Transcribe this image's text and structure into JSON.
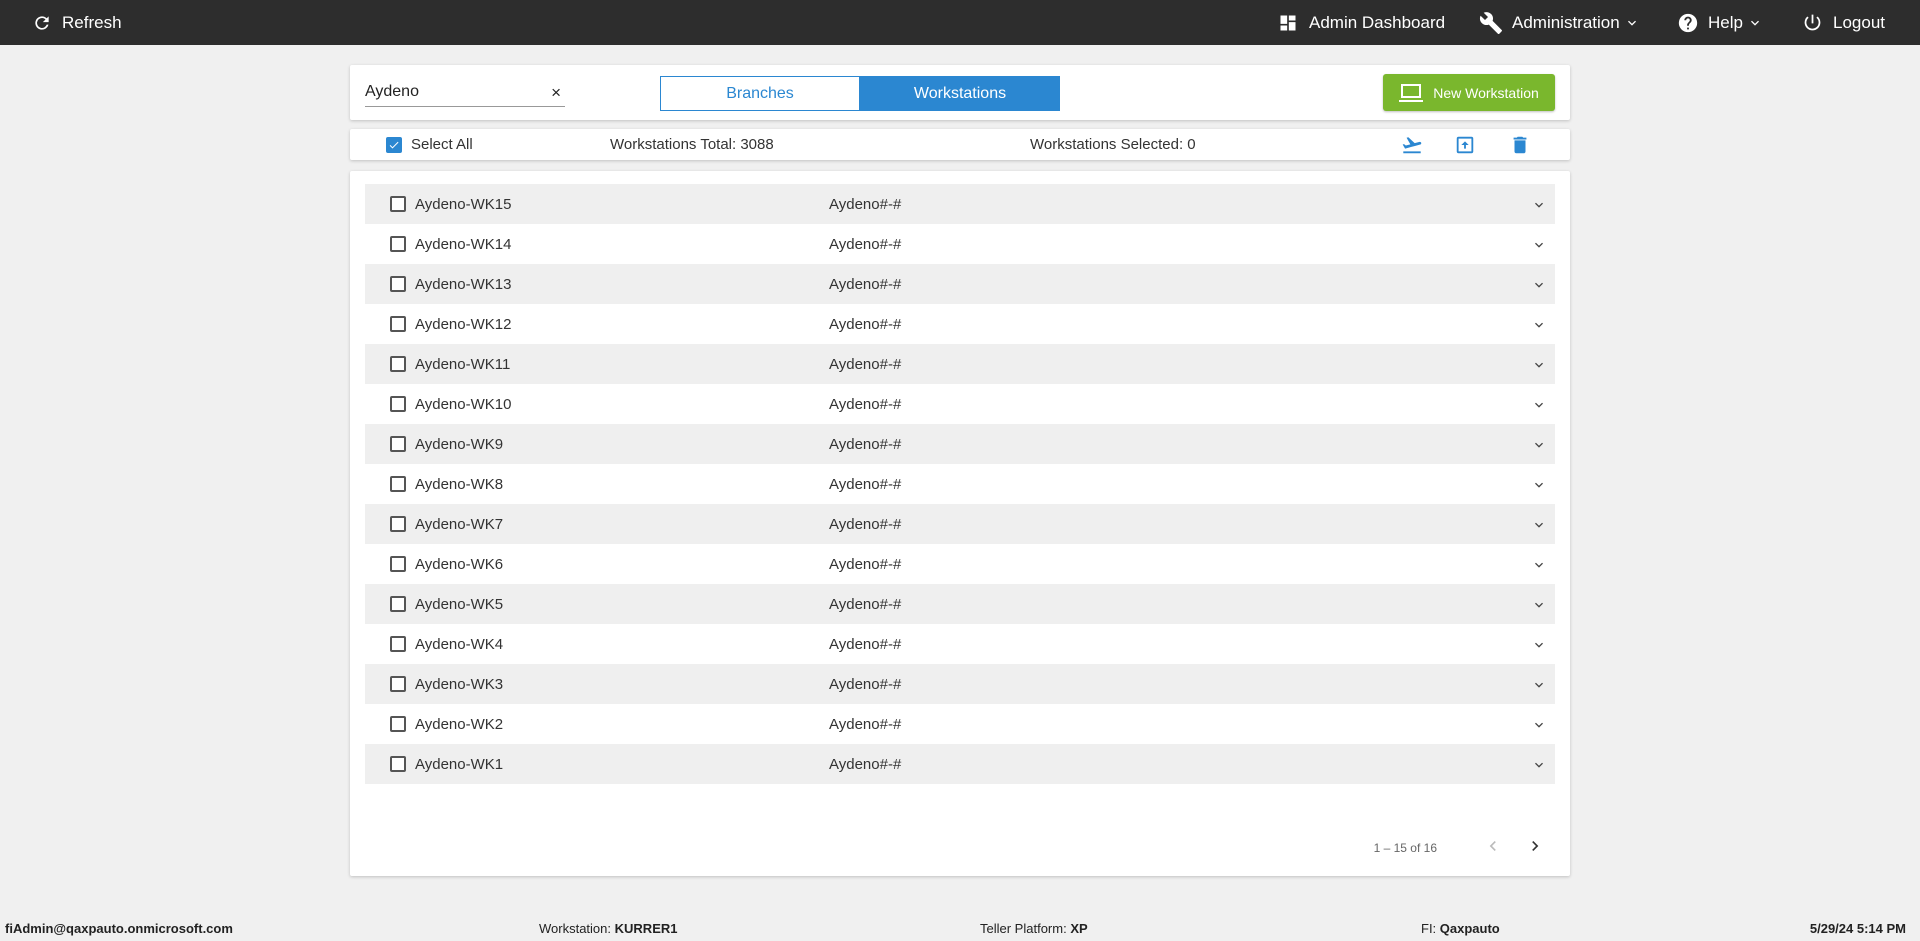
{
  "topbar": {
    "refresh_label": "Refresh",
    "admin_dashboard_label": "Admin Dashboard",
    "administration_label": "Administration",
    "help_label": "Help",
    "logout_label": "Logout"
  },
  "header": {
    "search_value": "Aydeno",
    "clear_symbol": "×",
    "tab_branches": "Branches",
    "tab_workstations": "Workstations",
    "new_workstation_label": "New Workstation"
  },
  "toolbar": {
    "select_all_label": "Select All",
    "select_all_checked": true,
    "workstations_total": "Workstations Total: 3088",
    "workstations_selected": "Workstations Selected: 0"
  },
  "workstations": [
    {
      "name": "Aydeno-WK15",
      "desc": "Aydeno#-#"
    },
    {
      "name": "Aydeno-WK14",
      "desc": "Aydeno#-#"
    },
    {
      "name": "Aydeno-WK13",
      "desc": "Aydeno#-#"
    },
    {
      "name": "Aydeno-WK12",
      "desc": "Aydeno#-#"
    },
    {
      "name": "Aydeno-WK11",
      "desc": "Aydeno#-#"
    },
    {
      "name": "Aydeno-WK10",
      "desc": "Aydeno#-#"
    },
    {
      "name": "Aydeno-WK9",
      "desc": "Aydeno#-#"
    },
    {
      "name": "Aydeno-WK8",
      "desc": "Aydeno#-#"
    },
    {
      "name": "Aydeno-WK7",
      "desc": "Aydeno#-#"
    },
    {
      "name": "Aydeno-WK6",
      "desc": "Aydeno#-#"
    },
    {
      "name": "Aydeno-WK5",
      "desc": "Aydeno#-#"
    },
    {
      "name": "Aydeno-WK4",
      "desc": "Aydeno#-#"
    },
    {
      "name": "Aydeno-WK3",
      "desc": "Aydeno#-#"
    },
    {
      "name": "Aydeno-WK2",
      "desc": "Aydeno#-#"
    },
    {
      "name": "Aydeno-WK1",
      "desc": "Aydeno#-#"
    }
  ],
  "pager": {
    "range_label": "1 – 15 of 16"
  },
  "footer": {
    "user": "fiAdmin@qaxpauto.onmicrosoft.com",
    "workstation_label": "Workstation:",
    "workstation_value": "KURRER1",
    "teller_platform_label": "Teller Platform:",
    "teller_platform_value": "XP",
    "fi_label": "FI:",
    "fi_value": "Qaxpauto",
    "datetime": "5/29/24 5:14 PM"
  },
  "colors": {
    "topbar_bg": "#2d2d2d",
    "accent_blue": "#2b87d1",
    "new_button_green": "#7ab72d",
    "row_stripe": "#efefef"
  },
  "icons": {
    "refresh": "refresh-icon",
    "dashboard": "dashboard-grid-icon",
    "administration": "wrench-icon",
    "help": "help-circle-icon",
    "logout": "power-icon",
    "new_workstation": "laptop-icon",
    "toolbar": [
      "airplane-takeoff-icon",
      "upload-box-icon",
      "trash-icon"
    ]
  }
}
